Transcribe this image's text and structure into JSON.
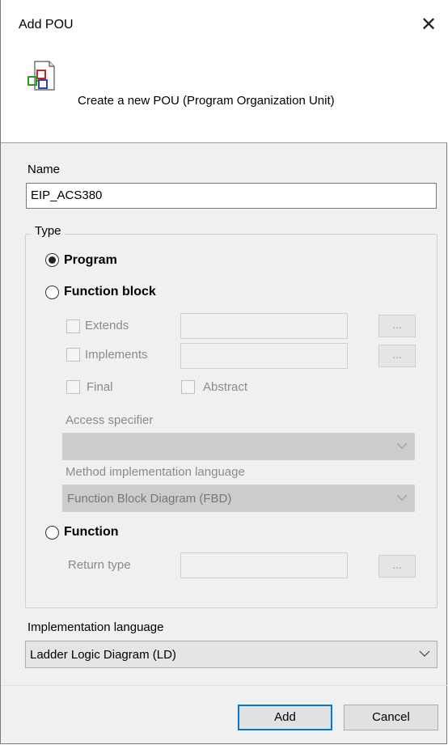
{
  "dialog": {
    "title": "Add POU",
    "close_icon": "close-icon",
    "header_text": "Create a new POU (Program Organization Unit)",
    "header_icon": "pou-icon"
  },
  "name": {
    "label": "Name",
    "value": "EIP_ACS380"
  },
  "type": {
    "group_label": "Type",
    "program_label": "Program",
    "program_selected": true,
    "function_block_label": "Function block",
    "extends_label": "Extends",
    "implements_label": "Implements",
    "final_label": "Final",
    "abstract_label": "Abstract",
    "browse_label": "...",
    "access_specifier_label": "Access specifier",
    "access_specifier_value": "",
    "method_language_label": "Method implementation language",
    "method_language_value": "Function Block Diagram (FBD)",
    "function_label": "Function",
    "return_type_label": "Return type"
  },
  "implementation": {
    "label": "Implementation language",
    "value": "Ladder Logic Diagram (LD)"
  },
  "buttons": {
    "add": "Add",
    "cancel": "Cancel"
  }
}
